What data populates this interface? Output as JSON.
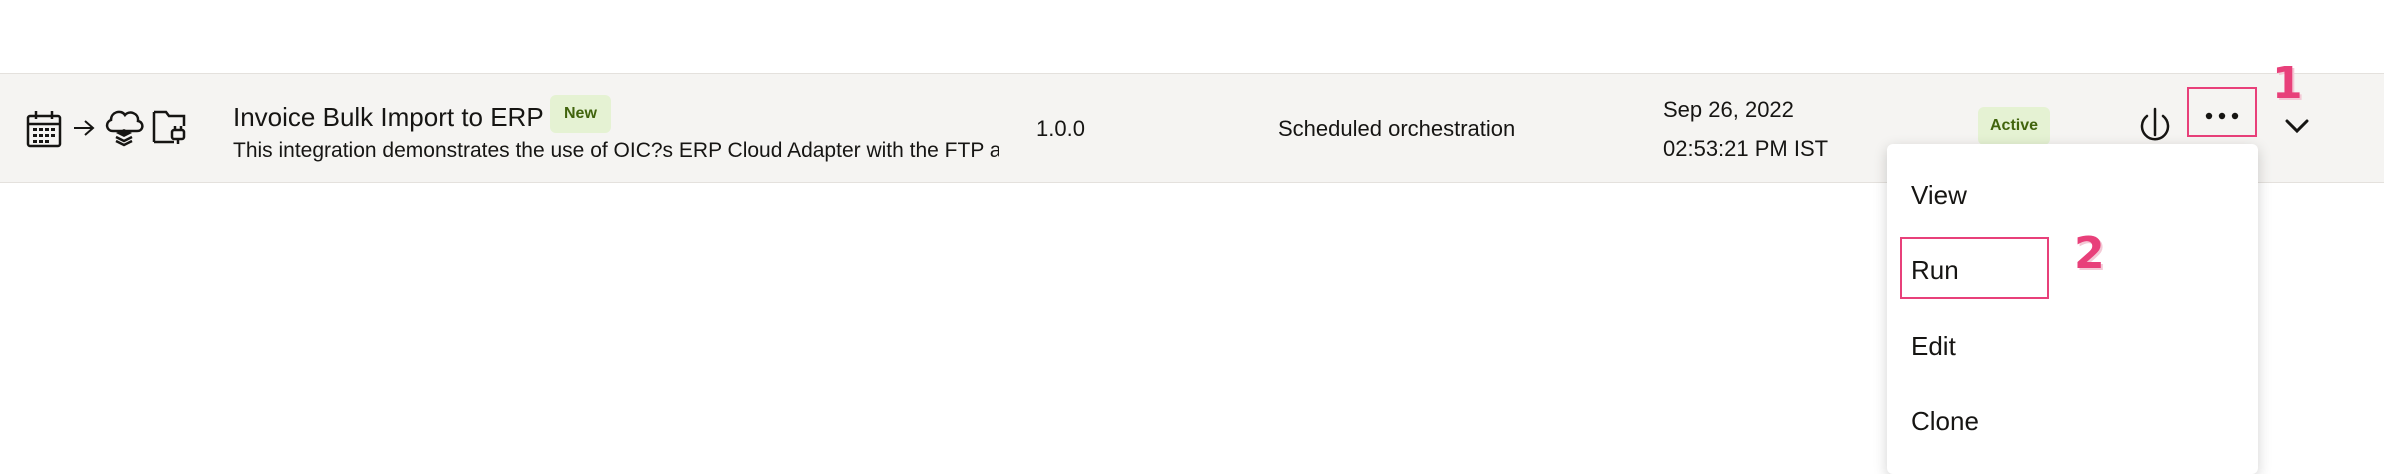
{
  "integration_row": {
    "name": "Invoice Bulk Import to ERP",
    "new_badge": "New",
    "description": "This integration demonstrates the use of OIC?s ERP Cloud Adapter with the FTP a",
    "version": "1.0.0",
    "style": "Scheduled orchestration",
    "last_updated_date": "Sep 26, 2022",
    "last_updated_time": "02:53:21 PM IST",
    "status": "Active",
    "flow_icons": [
      "calendar-icon",
      "arrow-right-icon",
      "cloud-layers-icon",
      "folder-plug-icon"
    ],
    "action_icons": [
      "power-icon",
      "more-actions-icon",
      "chevron-down-icon"
    ]
  },
  "actions_menu": {
    "items": [
      {
        "label": "View"
      },
      {
        "label": "Run"
      },
      {
        "label": "Edit"
      },
      {
        "label": "Clone"
      }
    ]
  },
  "annotations": {
    "step1": "1",
    "step2": "2"
  },
  "colors": {
    "row_background": "#f5f4f2",
    "badge_background": "#e5f2d3",
    "badge_text": "#41640d",
    "annotation": "#e8407a"
  }
}
